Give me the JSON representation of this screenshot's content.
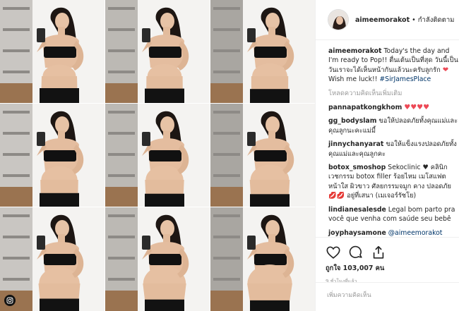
{
  "post": {
    "username": "aimeemorakot",
    "follow_status": "กำลังติดตาม",
    "separator": "•"
  },
  "comments": {
    "caption": {
      "user": "aimeemorakot",
      "text": "Today's the day and I'm ready to Pop!! ตื่นเต้นเป็นที่สุด วันนี้เป็นวันเราจะได้เห็นหน้ากันแล้วนะครับลูกรัก",
      "text_end": "Wish me luck!!",
      "hashtag": "#SirJamesPlace"
    },
    "load_more": "โหลดความคิดเห็นเพิ่มเติม",
    "items": [
      {
        "user": "pannapatkongkhom",
        "text": "♥♥♥♥"
      },
      {
        "user": "gg_bodyslam",
        "text": "ขอให้ปลอดภัยทั้งคุณแม่และคุณลูกนะคะแม่มี้"
      },
      {
        "user": "jinnychanyarat",
        "text": "ขอให้แข็งแรงปลอดภัยทั้งคุณแม่และคุณลูกคะ"
      },
      {
        "user": "botox_smoshop",
        "text": "Sekoclinic ♥ คลินิกเวชกรรม botox filler ร้อยไหม เมโสแฟตหน้าใส ผิวขาว ศัลยกรรมจมูก คาง ปลอดภัย 💋💋 อยู่ที่เสนา (เมเจอร์รัชโย)"
      },
      {
        "user": "lindianesalesde",
        "text": "Legal bom parto pra você que venha com saúde seu bebê"
      },
      {
        "user": "joyphaysamone",
        "mention": "@aimeemorakot"
      }
    ]
  },
  "actions": {
    "likes": "ถูกใจ 103,007 คน",
    "time": "9 ชั่วโมงที่แล้ว",
    "add_comment": "เพิ่มความคิดเห็น"
  },
  "icons": {
    "like": "heart-icon",
    "comment": "comment-icon",
    "share": "share-icon",
    "instagram": "instagram-icon"
  },
  "colors": {
    "text": "#262626",
    "muted": "#999999",
    "link": "#003569",
    "heart": "#ed4956",
    "border": "#efefef"
  }
}
